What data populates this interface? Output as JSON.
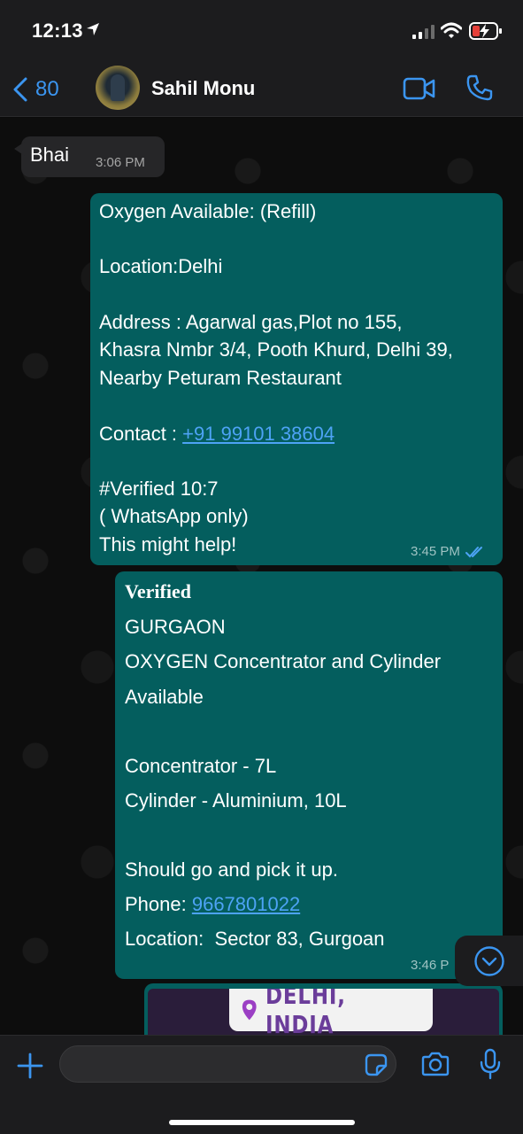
{
  "status_bar": {
    "time": "12:13"
  },
  "header": {
    "back_count": "80",
    "contact_name": "Sahil Monu"
  },
  "messages": {
    "incoming": {
      "text": "Bhai",
      "time": "3:06 PM"
    },
    "outgoing_1": {
      "lines": [
        "Oxygen Available: (Refill)",
        "Location:Delhi",
        "Address : Agarwal gas,Plot no 155,",
        "Khasra Nmbr 3/4, Pooth Khurd, Delhi 39,",
        "Nearby Peturam Restaurant",
        "Contact : ",
        "#Verified 10:7",
        "( WhatsApp only)",
        "This might help!"
      ],
      "phone": "+91 99101 38604",
      "time": "3:45 PM"
    },
    "outgoing_2": {
      "verified": "Verified",
      "lines": [
        "GURGAON",
        "OXYGEN Concentrator and Cylinder",
        "Available",
        "Concentrator - 7L",
        "Cylinder - Aluminium, 10L",
        "Should go and pick it up.",
        "Phone: ",
        "Location:  Sector 83, Gurgoan"
      ],
      "phone": "9667801022",
      "time": "3:46 P"
    },
    "image_preview": {
      "text": "DELHI, INDIA"
    }
  },
  "input": {
    "value": ""
  },
  "colors": {
    "accent": "#3b95f0",
    "outgoing_bubble": "#045e5e",
    "incoming_bubble": "#262628",
    "link": "#4da3f5"
  },
  "icons": [
    "location-arrow-icon",
    "signal-icon",
    "wifi-icon",
    "battery-charging-icon",
    "chevron-left-icon",
    "video-camera-icon",
    "phone-icon",
    "double-check-icon",
    "chevron-down-circle-icon",
    "plus-icon",
    "sticker-icon",
    "camera-icon",
    "microphone-icon",
    "map-pin-icon"
  ]
}
